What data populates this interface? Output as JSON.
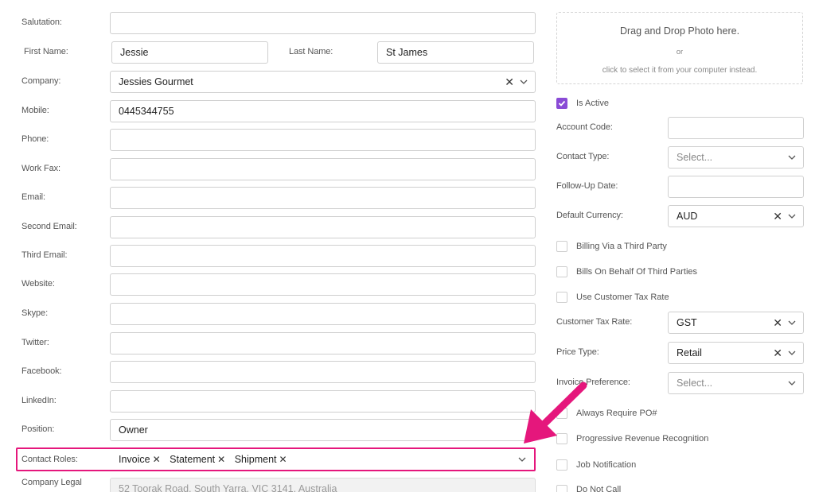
{
  "left": {
    "salutation": {
      "label": "Salutation:",
      "value": ""
    },
    "first_name": {
      "label": "First Name:",
      "value": "Jessie"
    },
    "last_name": {
      "label": "Last Name:",
      "value": "St James"
    },
    "company": {
      "label": "Company:",
      "value": "Jessies Gourmet"
    },
    "mobile": {
      "label": "Mobile:",
      "value": "0445344755"
    },
    "phone": {
      "label": "Phone:",
      "value": ""
    },
    "work_fax": {
      "label": "Work Fax:",
      "value": ""
    },
    "email": {
      "label": "Email:",
      "value": ""
    },
    "second_email": {
      "label": "Second Email:",
      "value": ""
    },
    "third_email": {
      "label": "Third Email:",
      "value": ""
    },
    "website": {
      "label": "Website:",
      "value": ""
    },
    "skype": {
      "label": "Skype:",
      "value": ""
    },
    "twitter": {
      "label": "Twitter:",
      "value": ""
    },
    "facebook": {
      "label": "Facebook:",
      "value": ""
    },
    "linkedin": {
      "label": "LinkedIn:",
      "value": ""
    },
    "position": {
      "label": "Position:",
      "value": "Owner"
    },
    "contact_roles": {
      "label": "Contact Roles:",
      "chips": [
        "Invoice",
        "Statement",
        "Shipment"
      ]
    },
    "company_legal": {
      "label": "Company Legal",
      "value": "52 Toorak Road, South Yarra, VIC 3141, Australia"
    }
  },
  "photo": {
    "title": "Drag and Drop Photo here.",
    "or": "or",
    "sub": "click to select it from your computer instead."
  },
  "right": {
    "is_active": {
      "label": "Is Active",
      "checked": true
    },
    "account_code": {
      "label": "Account Code:",
      "value": ""
    },
    "contact_type": {
      "label": "Contact Type:",
      "placeholder": "Select..."
    },
    "follow_up": {
      "label": "Follow-Up Date:",
      "value": ""
    },
    "default_currency": {
      "label": "Default Currency:",
      "value": "AUD"
    },
    "billing_third": {
      "label": "Billing Via a Third Party"
    },
    "bills_behalf": {
      "label": "Bills On Behalf Of Third Parties"
    },
    "use_tax_rate": {
      "label": "Use Customer Tax Rate"
    },
    "customer_tax_rate": {
      "label": "Customer Tax Rate:",
      "value": "GST"
    },
    "price_type": {
      "label": "Price Type:",
      "value": "Retail"
    },
    "invoice_pref": {
      "label": "Invoice Preference:",
      "placeholder": "Select..."
    },
    "always_po": {
      "label": "Always Require PO#"
    },
    "progressive": {
      "label": "Progressive Revenue Recognition"
    },
    "job_notification": {
      "label": "Job Notification"
    },
    "do_not_call": {
      "label": "Do Not Call"
    }
  },
  "colors": {
    "accent": "#8a4bd6",
    "highlight": "#e5177c"
  },
  "icons": {
    "clear": "x-icon",
    "dropdown": "chevron-down-icon",
    "arrow": "annotation-arrow-icon"
  }
}
